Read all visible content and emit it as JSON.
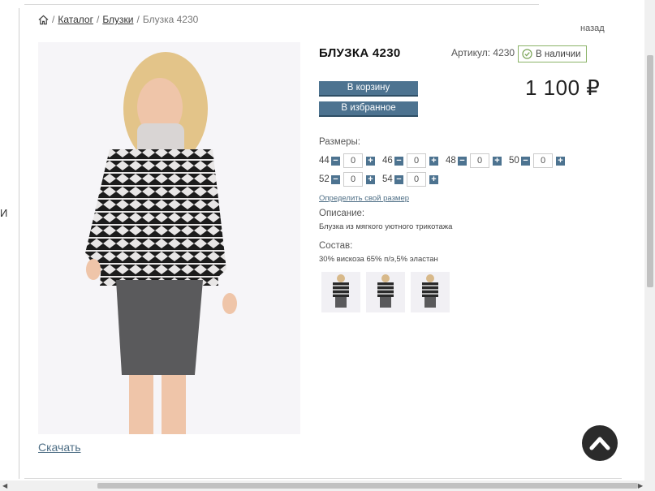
{
  "breadcrumb": {
    "sep": "/",
    "catalog": "Каталог",
    "category": "Блузки",
    "current": "Блузка 4230"
  },
  "back_label": "назад",
  "left_stub": "И",
  "product": {
    "title": "БЛУЗКА 4230",
    "article": "Артикул: 4230",
    "stock": "В наличии",
    "price": "1 100 ₽",
    "cart_label": "В корзину",
    "favorite_label": "В избранное"
  },
  "sizes": {
    "label": "Размеры:",
    "items": [
      {
        "size": "44",
        "qty": "0"
      },
      {
        "size": "46",
        "qty": "0"
      },
      {
        "size": "48",
        "qty": "0"
      },
      {
        "size": "50",
        "qty": "0"
      },
      {
        "size": "52",
        "qty": "0"
      },
      {
        "size": "54",
        "qty": "0"
      }
    ],
    "help_link": "Определить свой размер"
  },
  "description": {
    "label": "Описание:",
    "text": "Блузка из мягкого уютного трикотажа"
  },
  "composition": {
    "label": "Состав:",
    "text": "30% вискоза 65% п/э,5% эластан"
  },
  "download_label": "Скачать",
  "colors": {
    "accent": "#4d7390",
    "stock_border": "#8bb368",
    "link": "#4f6f86"
  }
}
